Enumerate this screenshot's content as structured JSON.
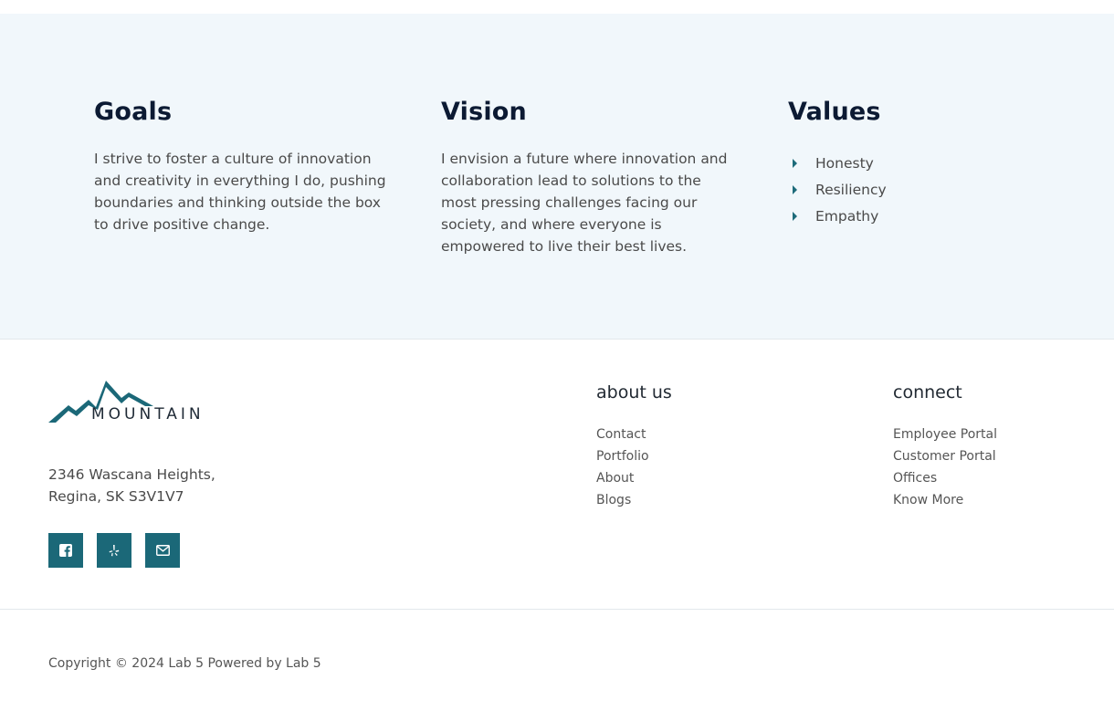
{
  "mission": {
    "goals": {
      "title": "Goals",
      "text": "I strive to foster a culture of innovation and creativity in everything I do, pushing boundaries and thinking outside the box to drive positive change."
    },
    "vision": {
      "title": "Vision",
      "text": "I envision a future where innovation and collaboration lead to solutions to the most pressing challenges facing our society, and where everyone is empowered to live their best lives."
    },
    "values": {
      "title": "Values",
      "items": [
        "Honesty",
        "Resiliency",
        "Empathy"
      ],
      "bullet_icon": "caret-right-icon",
      "bullet_color": "#1d6b7a"
    }
  },
  "footer": {
    "logo": {
      "text": "MOUNTAIN",
      "icon": "mountain-logo-icon",
      "color": "#1b6878"
    },
    "address": {
      "line1": "2346 Wascana Heights,",
      "line2": "Regina, SK S3V1V7"
    },
    "socials": [
      {
        "icon": "facebook-icon"
      },
      {
        "icon": "yelp-icon"
      },
      {
        "icon": "envelope-icon"
      }
    ],
    "social_bg": "#1b6878",
    "about": {
      "title": "about us",
      "links": [
        "Contact",
        "Portfolio",
        "About",
        "Blogs"
      ]
    },
    "connect": {
      "title": "connect",
      "links": [
        "Employee Portal",
        "Customer Portal",
        "Offices",
        "Know More"
      ]
    }
  },
  "bottom": {
    "copyright": "Copyright © 2024 Lab 5 Powered by Lab 5"
  },
  "colors": {
    "section_bg": "#f1f7fb",
    "heading": "#0c1a33",
    "accent": "#1b6878"
  }
}
